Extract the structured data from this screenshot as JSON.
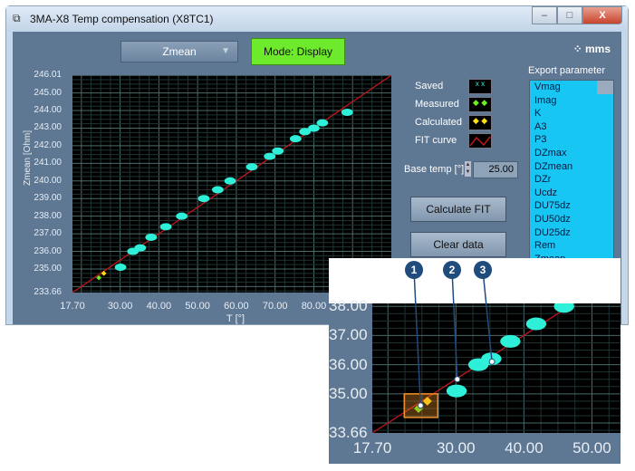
{
  "window": {
    "title": "3MA-X8 Temp compensation (X8TC1)",
    "minimize": "–",
    "maximize": "□",
    "close": "X"
  },
  "toolbar": {
    "channel_select": "Zmean",
    "mode_button": "Mode: Display",
    "logo": "mms"
  },
  "legend": [
    {
      "label": "Saved"
    },
    {
      "label": "Measured"
    },
    {
      "label": "Calculated"
    },
    {
      "label": "FIT curve"
    }
  ],
  "base_temp": {
    "label": "Base temp [°]",
    "value": "25.00"
  },
  "buttons": {
    "calculate_fit": "Calculate FIT",
    "clear_data": "Clear data"
  },
  "export": {
    "label": "Export parameter",
    "items": [
      "Vmag",
      "Imag",
      "K",
      "A3",
      "P3",
      "DZmax",
      "DZmean",
      "DZr",
      "Ucdz",
      "DU75dz",
      "DU50dz",
      "DU25dz",
      "Rem",
      "Zmean"
    ]
  },
  "colors": {
    "saved": "#2ef0d8",
    "measured": "#6cf020",
    "calculated": "#ffe010",
    "fit": "#c0141c",
    "mode_on": "#6dea2c"
  },
  "callouts": [
    "1",
    "2",
    "3"
  ],
  "chart_data": {
    "type": "scatter",
    "xlabel": "T [°]",
    "ylabel": "Zmean [Ohm]",
    "xlim": [
      17.7,
      100
    ],
    "ylim": [
      233.66,
      246.01
    ],
    "x_ticks": [
      "17.70",
      "30.00",
      "40.00",
      "50.00",
      "60.00",
      "70.00",
      "80.00"
    ],
    "y_ticks": [
      "246.01",
      "245.00",
      "244.00",
      "243.00",
      "242.00",
      "241.00",
      "240.00",
      "239.00",
      "238.00",
      "237.00",
      "236.00",
      "235.00",
      "233.66"
    ],
    "grid": true,
    "saved": [
      [
        30.1,
        235.1
      ],
      [
        33.3,
        236.0
      ],
      [
        35.2,
        236.2
      ],
      [
        38.0,
        236.8
      ],
      [
        41.8,
        237.4
      ],
      [
        45.9,
        238.0
      ],
      [
        51.6,
        239.0
      ],
      [
        55.2,
        239.5
      ],
      [
        58.4,
        240.0
      ],
      [
        64.0,
        240.8
      ],
      [
        68.6,
        241.4
      ],
      [
        70.7,
        241.7
      ],
      [
        75.3,
        242.4
      ],
      [
        77.7,
        242.8
      ],
      [
        80.0,
        243.0
      ],
      [
        82.2,
        243.3
      ],
      [
        88.6,
        243.9
      ]
    ],
    "measured": [
      [
        24.5,
        234.5
      ]
    ],
    "calculated": [
      [
        25.8,
        234.75
      ]
    ],
    "fit": {
      "x0": 17.7,
      "y0": 233.66,
      "slope": 0.15
    },
    "inset": {
      "xlim": [
        17.7,
        55
      ],
      "ylim": [
        233.66,
        238.1
      ],
      "x_ticks": [
        "17.70",
        "30.00",
        "40.00",
        "50.00"
      ],
      "y_ticks": [
        "38.00",
        "37.00",
        "36.00",
        "35.00",
        "33.66"
      ]
    }
  }
}
